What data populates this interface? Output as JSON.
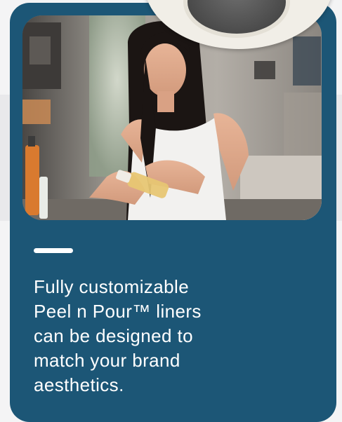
{
  "card": {
    "caption_lines": [
      "Fully customizable",
      "Peel n Pour™ liners",
      "can be designed to",
      "match your brand",
      "aesthetics."
    ]
  },
  "colors": {
    "card_background": "#1c5676",
    "accent_bar": "#ffffff",
    "caption_text": "#ffffff",
    "page_background": "#f4f4f5"
  },
  "icons": {
    "product_lid": "jar-lid-image",
    "photo": "woman-pouring-oil-photo"
  }
}
